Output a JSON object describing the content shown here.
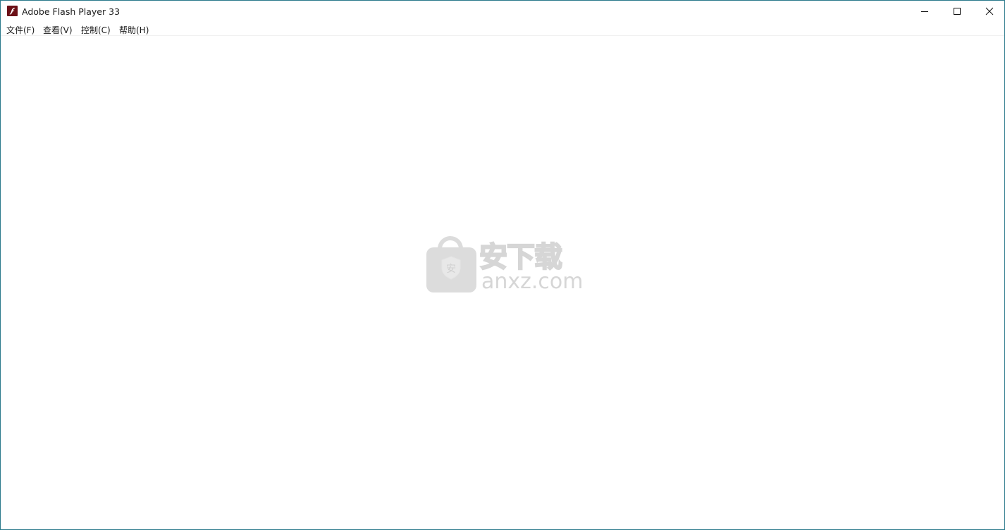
{
  "window": {
    "title": "Adobe Flash Player 33",
    "app_icon": "flash-player-icon",
    "controls": {
      "minimize": "minimize-icon",
      "maximize": "maximize-icon",
      "close": "close-icon"
    }
  },
  "menubar": {
    "items": [
      {
        "label": "文件(F)"
      },
      {
        "label": "查看(V)"
      },
      {
        "label": "控制(C)"
      },
      {
        "label": "帮助(H)"
      }
    ]
  },
  "watermark": {
    "icon": "shield-bag-icon",
    "shield_char": "安",
    "cn_text": "安下载",
    "en_text": "anxz.com"
  },
  "colors": {
    "border": "#2b7a8c",
    "flash_icon_bg": "#6b0f16",
    "watermark_gray": "#dcdcdc"
  }
}
